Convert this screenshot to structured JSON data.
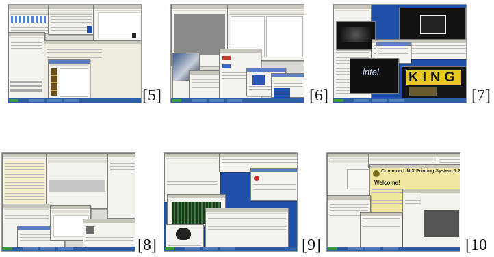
{
  "figures": [
    {
      "label": "[5]",
      "tile": "screenshot-5"
    },
    {
      "label": "[6]",
      "tile": "screenshot-6"
    },
    {
      "label": "[7]",
      "tile": "screenshot-7"
    },
    {
      "label": "[8]",
      "tile": "screenshot-8"
    },
    {
      "label": "[9]",
      "tile": "screenshot-9"
    },
    {
      "label": "[10",
      "tile": "screenshot-10"
    }
  ],
  "texts": {
    "intel": "intel",
    "king": "KING",
    "cups_title": "Common UNIX Printing System 1.2",
    "welcome": "Welcome!"
  },
  "colors": {
    "desktop_blue": "#1f4fa6",
    "taskbar": "#2d5fa8",
    "window_bg": "#f4f3ee",
    "panel_grey": "#dcdad5",
    "cups_yellow": "#f1e7a0",
    "king_yellow": "#e8c81e"
  }
}
